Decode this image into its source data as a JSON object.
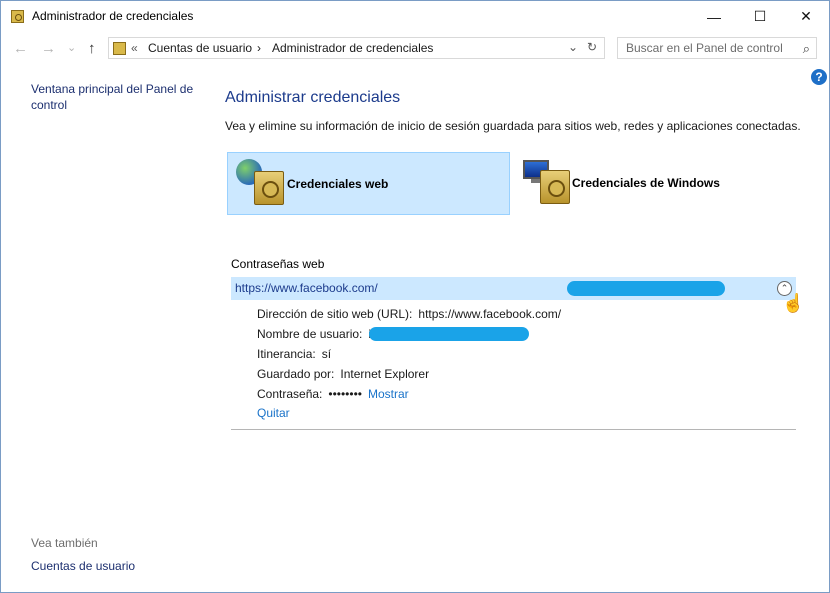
{
  "window": {
    "title": "Administrador de credenciales",
    "controls": {
      "minimize": "—",
      "maximize": "☐",
      "close": "✕"
    }
  },
  "navbar": {
    "back": "←",
    "forward": "→",
    "recent": "⌄",
    "up": "↑",
    "breadcrumb_sep": "«",
    "crumbs": [
      "Cuentas de usuario",
      "Administrador de credenciales"
    ],
    "crumb_arrow": "›",
    "dropdown": "⌄",
    "refresh": "↻",
    "search_placeholder": "Buscar en el Panel de control",
    "search_icon": "⌕"
  },
  "help_icon": "?",
  "sidebar": {
    "home_link": "Ventana principal del Panel de control",
    "see_also": "Vea también",
    "user_accounts": "Cuentas de usuario"
  },
  "main": {
    "heading": "Administrar credenciales",
    "description": "Vea y elimine su información de inicio de sesión guardada para sitios web, redes y aplicaciones conectadas.",
    "tiles": {
      "web": "Credenciales web",
      "windows": "Credenciales de Windows"
    },
    "section_label": "Contraseñas web",
    "credential": {
      "url": "https://www.facebook.com/",
      "collapse_icon": "⌃",
      "fields": {
        "site_label": "Dirección de sitio web (URL):",
        "site_value": "https://www.facebook.com/",
        "user_label": "Nombre de usuario:",
        "user_prefix": "i",
        "roaming_label": "Itinerancia:",
        "roaming_value": "sí",
        "saved_by_label": "Guardado por:",
        "saved_by_value": "Internet Explorer",
        "password_label": "Contraseña:",
        "password_value": "••••••••",
        "show_link": "Mostrar",
        "remove_link": "Quitar"
      }
    }
  },
  "cursor": "☝"
}
